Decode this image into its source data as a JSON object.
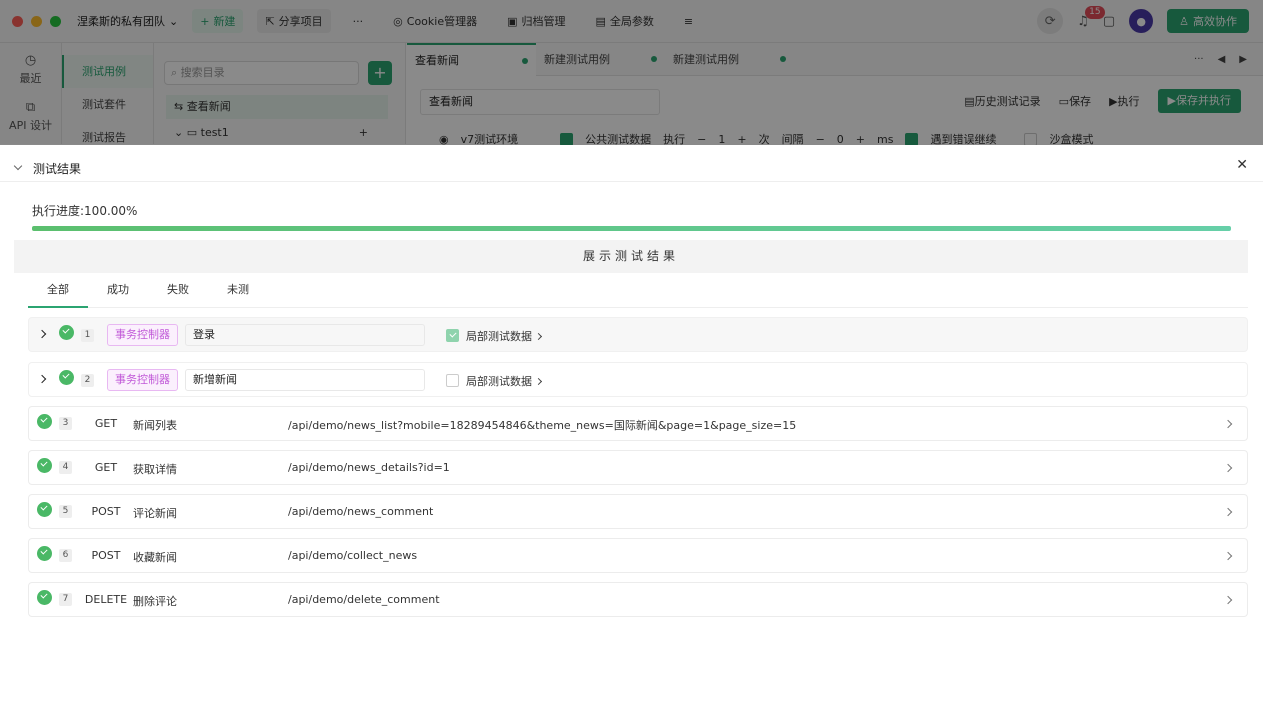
{
  "titlebar": {
    "team_name": "涅柔斯的私有团队",
    "new_label": "新建",
    "share_label": "分享项目",
    "cookie_label": "Cookie管理器",
    "archive_label": "归档管理",
    "global_params_label": "全局参数",
    "notification_count": "15",
    "collab_label": "高效协作"
  },
  "leftnav": {
    "recent": "最近",
    "api_design": "API 设计"
  },
  "subnav": {
    "items": [
      "测试用例",
      "测试套件",
      "测试报告"
    ]
  },
  "tree": {
    "search_placeholder": "搜索目录",
    "items": [
      "查看新闻",
      "test1"
    ]
  },
  "editor": {
    "tabs": [
      "查看新闻",
      "新建测试用例",
      "新建测试用例"
    ],
    "name_value": "查看新闻",
    "history_label": "历史测试记录",
    "save_label": "保存",
    "run_label": "执行",
    "save_run_label": "保存并执行",
    "env_label": "v7测试环境",
    "public_data_label": "公共测试数据",
    "exec_label": "执行",
    "exec_count": "1",
    "times_label": "次",
    "interval_label": "间隔",
    "interval_value": "0",
    "ms_label": "ms",
    "continue_label": "遇到错误继续",
    "sandbox_label": "沙盒模式"
  },
  "panel": {
    "title": "测试结果",
    "progress_text": "执行进度:100.00%",
    "progress_value": 1.0,
    "banner": "展示测试结果",
    "filters": [
      "全部",
      "成功",
      "失败",
      "未测"
    ]
  },
  "results": {
    "controllers": [
      {
        "index": "1",
        "tag": "事务控制器",
        "name": "登录",
        "local_label": "局部测试数据",
        "local_checked": true
      },
      {
        "index": "2",
        "tag": "事务控制器",
        "name": "新增新闻",
        "local_label": "局部测试数据",
        "local_checked": false
      }
    ],
    "requests": [
      {
        "index": "3",
        "method": "GET",
        "name": "新闻列表",
        "path": "/api/demo/news_list?mobile=18289454846&theme_news=国际新闻&page=1&page_size=15"
      },
      {
        "index": "4",
        "method": "GET",
        "name": "获取详情",
        "path": "/api/demo/news_details?id=1"
      },
      {
        "index": "5",
        "method": "POST",
        "name": "评论新闻",
        "path": "/api/demo/news_comment"
      },
      {
        "index": "6",
        "method": "POST",
        "name": "收藏新闻",
        "path": "/api/demo/collect_news"
      },
      {
        "index": "7",
        "method": "DELETE",
        "name": "删除评论",
        "path": "/api/demo/delete_comment"
      }
    ]
  },
  "colors": {
    "accent": "#2ba471",
    "success": "#4ab866",
    "controller_tag": "#c15ad8"
  }
}
